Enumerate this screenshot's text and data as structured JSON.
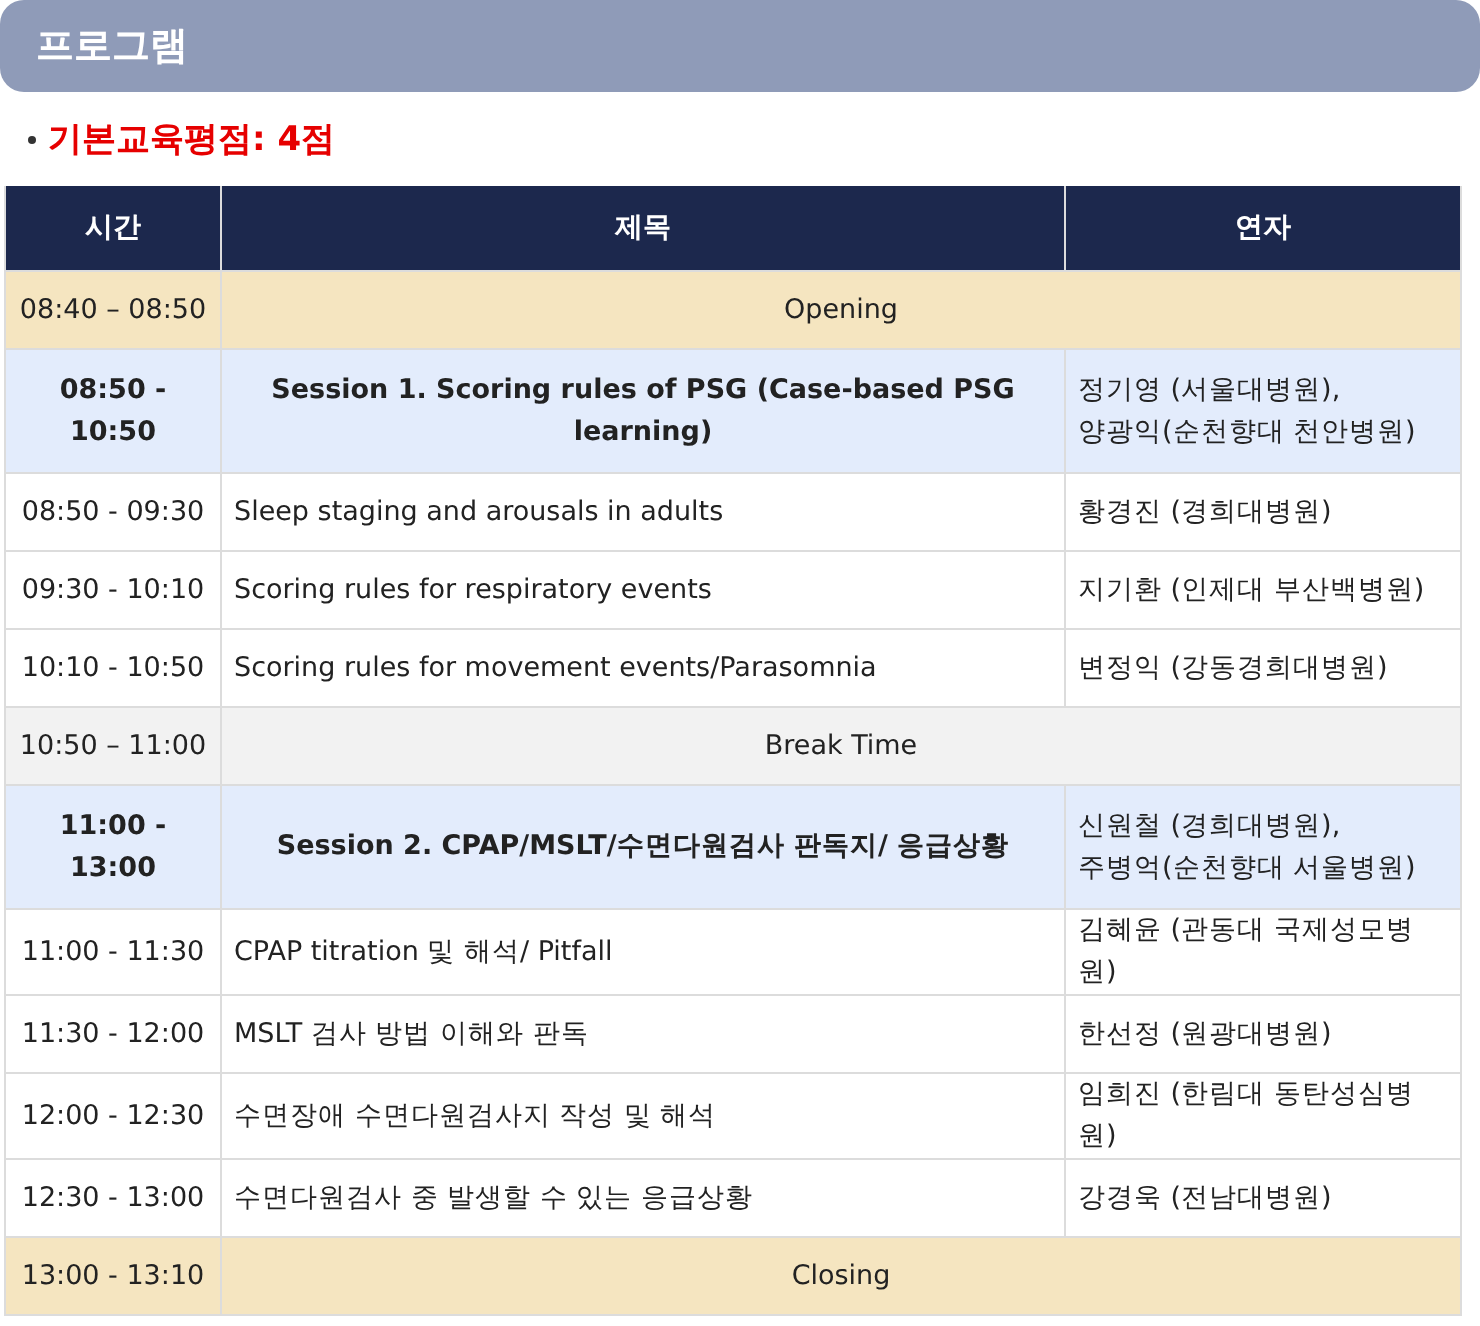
{
  "section_title": "프로그램",
  "credit_note": "기본교육평점: 4점",
  "table": {
    "columns": [
      "시간",
      "제목",
      "연자"
    ],
    "rows": [
      {
        "kind": "plenary",
        "time": "08:40 – 08:50",
        "title": "Opening"
      },
      {
        "kind": "session",
        "time": "08:50 - 10:50",
        "title": "Session 1. Scoring rules of PSG (Case-based PSG learning)",
        "speakers": [
          "정기영 (서울대병원),",
          "양광익(순천향대 천안병원)"
        ]
      },
      {
        "kind": "talk",
        "time": "08:50 - 09:30",
        "title": "Sleep staging and arousals in adults",
        "speakers": [
          "황경진 (경희대병원)"
        ]
      },
      {
        "kind": "talk",
        "time": "09:30 - 10:10",
        "title": "Scoring rules for respiratory events",
        "speakers": [
          "지기환 (인제대 부산백병원)"
        ]
      },
      {
        "kind": "talk",
        "time": "10:10 - 10:50",
        "title": "Scoring rules for movement events/Parasomnia",
        "speakers": [
          "변정익 (강동경희대병원)"
        ]
      },
      {
        "kind": "break",
        "time": "10:50 – 11:00",
        "title": "Break Time"
      },
      {
        "kind": "session",
        "time": "11:00 - 13:00",
        "title": "Session 2. CPAP/MSLT/수면다원검사 판독지/ 응급상황",
        "speakers": [
          "신원철 (경희대병원),",
          "주병억(순천향대 서울병원)"
        ]
      },
      {
        "kind": "talk",
        "time": "11:00 - 11:30",
        "title": "CPAP titration 및 해석/ Pitfall",
        "speakers": [
          "김혜윤 (관동대 국제성모병원)"
        ]
      },
      {
        "kind": "talk",
        "time": "11:30 - 12:00",
        "title": "MSLT 검사 방법 이해와 판독",
        "speakers": [
          "한선정 (원광대병원)"
        ]
      },
      {
        "kind": "talk",
        "time": "12:00 - 12:30",
        "title": "수면장애 수면다원검사지 작성 및 해석",
        "speakers": [
          "임희진 (한림대 동탄성심병원)"
        ]
      },
      {
        "kind": "talk",
        "time": "12:30 - 13:00",
        "title": "수면다원검사 중 발생할 수 있는 응급상황",
        "speakers": [
          "강경욱 (전남대병원)"
        ]
      },
      {
        "kind": "plenary",
        "time": "13:00 - 13:10",
        "title": "Closing"
      }
    ]
  }
}
